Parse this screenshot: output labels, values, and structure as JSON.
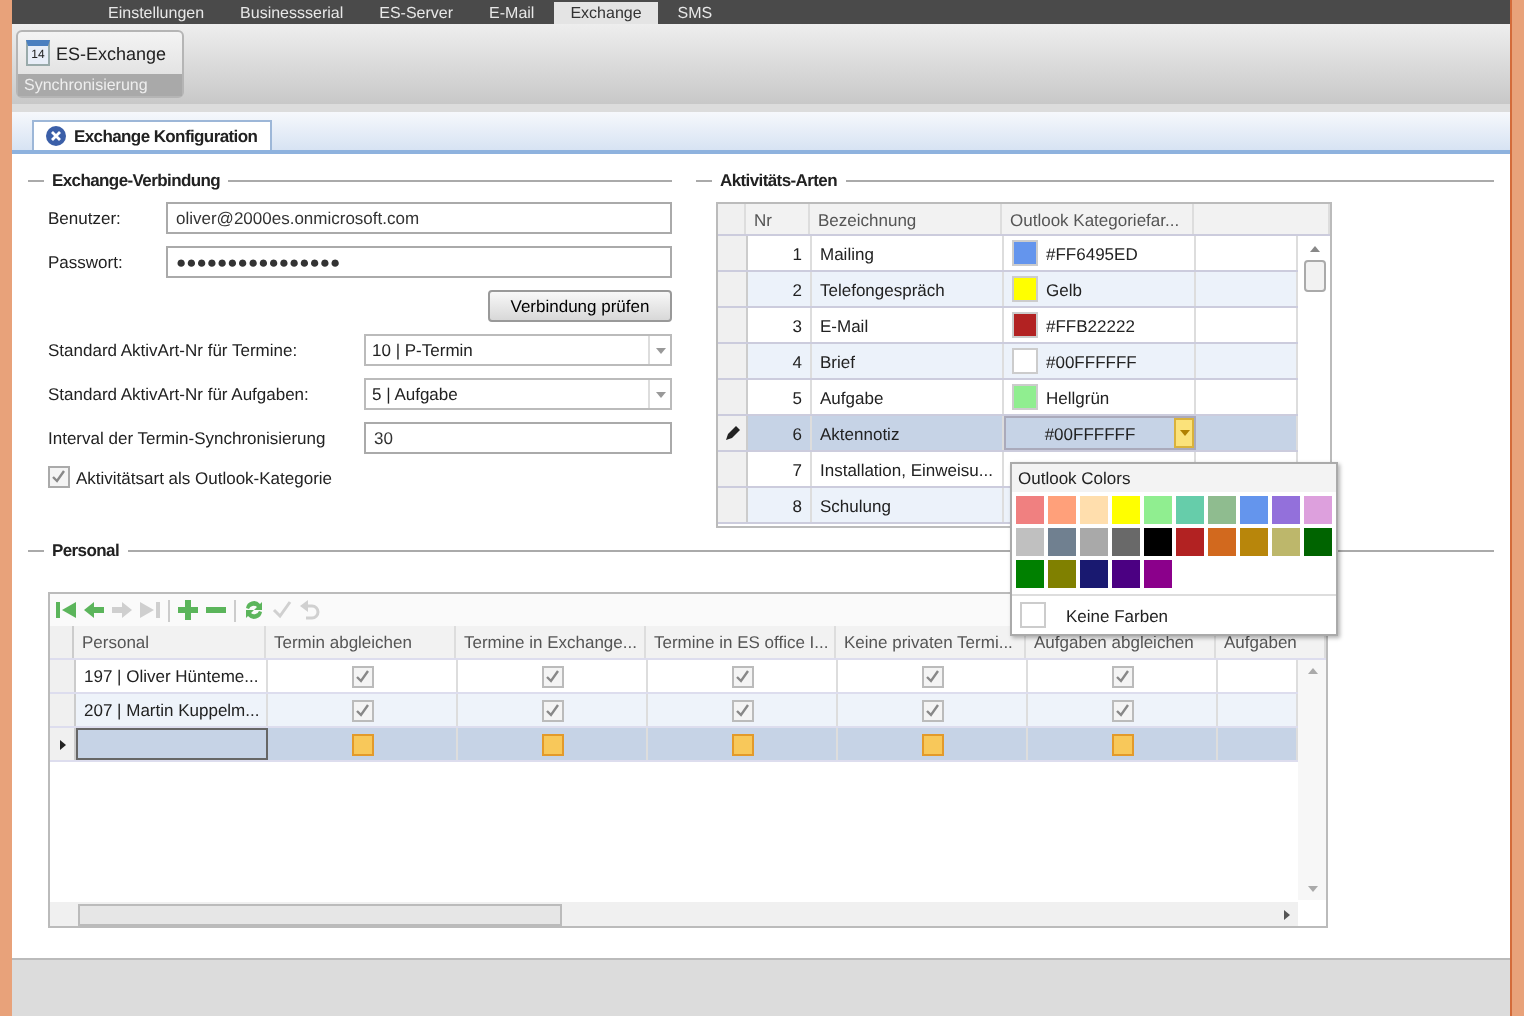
{
  "app_tabs": [
    {
      "label": "Einstellungen",
      "selected": false
    },
    {
      "label": "Businessserial",
      "selected": false
    },
    {
      "label": "ES-Server",
      "selected": false
    },
    {
      "label": "E-Mail",
      "selected": false
    },
    {
      "label": "Exchange",
      "selected": true
    },
    {
      "label": "SMS",
      "selected": false
    }
  ],
  "ribbon": {
    "button": {
      "icon_text": "14",
      "label": "ES-Exchange"
    },
    "group_label": "Synchronisierung"
  },
  "document_tab": {
    "label": "Exchange Konfiguration",
    "selected": true
  },
  "exchange_connection": {
    "title": "Exchange-Verbindung",
    "user": {
      "label": "Benutzer:",
      "value": "oliver@2000es.onmicrosoft.com"
    },
    "password": {
      "label": "Passwort:",
      "value": "●●●●●●●●●●●●●●●●"
    },
    "test_button": "Verbindung prüfen",
    "appointment_type": {
      "label": "Standard AktivArt-Nr für Termine:",
      "value": "10 | P-Termin"
    },
    "task_type": {
      "label": "Standard AktivArt-Nr für Aufgaben:",
      "value": "5 | Aufgabe"
    },
    "interval": {
      "label": "Interval der Termin-Synchronisierung",
      "value": "30"
    },
    "category_checkbox": {
      "label": "Aktivitätsart als Outlook-Kategorie",
      "checked": true
    }
  },
  "activity_types": {
    "title": "Aktivitäts-Arten",
    "columns": [
      "Nr",
      "Bezeichnung",
      "Outlook Kategoriefar..."
    ],
    "rows": [
      {
        "nr": "1",
        "name": "Mailing",
        "color": "#6495ed",
        "color_text": "#FF6495ED",
        "selected": false
      },
      {
        "nr": "2",
        "name": "Telefongespräch",
        "color": "#ffff00",
        "color_text": "Gelb",
        "selected": false
      },
      {
        "nr": "3",
        "name": "E-Mail",
        "color": "#b22222",
        "color_text": "#FFB22222",
        "selected": false
      },
      {
        "nr": "4",
        "name": "Brief",
        "color": "#ffffff",
        "color_text": "#00FFFFFF",
        "selected": false
      },
      {
        "nr": "5",
        "name": "Aufgabe",
        "color": "#90ee90",
        "color_text": "Hellgrün",
        "selected": false
      },
      {
        "nr": "6",
        "name": "Aktennotiz",
        "color_text": "#00FFFFFF",
        "selected": true
      },
      {
        "nr": "7",
        "name": "Installation, Einweisu...",
        "selected": false
      },
      {
        "nr": "8",
        "name": "Schulung",
        "selected": false
      }
    ],
    "color_popup": {
      "title": "Outlook Colors",
      "swatches": [
        {
          "color": "#f08080"
        },
        {
          "color": "#ffa07a"
        },
        {
          "color": "#ffdead"
        },
        {
          "color": "#ffff00"
        },
        {
          "color": "#90ee90"
        },
        {
          "color": "#66cdaa"
        },
        {
          "color": "#8fbc8f"
        },
        {
          "color": "#6495ed"
        },
        {
          "color": "#9370db"
        },
        {
          "color": "#dda0dd"
        },
        {
          "color": "#c0c0c0"
        },
        {
          "color": "#708090"
        },
        {
          "color": "#a9a9a9"
        },
        {
          "color": "#696969"
        },
        {
          "color": "#000000"
        },
        {
          "color": "#b22222"
        },
        {
          "color": "#d2691e"
        },
        {
          "color": "#b8860b"
        },
        {
          "color": "#bdb76b"
        },
        {
          "color": "#006400"
        },
        {
          "color": "#008000"
        },
        {
          "color": "#808000"
        },
        {
          "color": "#191970"
        },
        {
          "color": "#4b0082"
        },
        {
          "color": "#8b008b"
        }
      ],
      "no_color_label": "Keine Farben"
    }
  },
  "personnel": {
    "title": "Personal",
    "columns": [
      "Personal",
      "Termin abgleichen",
      "Termine in Exchange...",
      "Termine in ES office I...",
      "Keine privaten Termi...",
      "Aufgaben abgleichen",
      "Aufgaben"
    ],
    "rows": [
      {
        "kind": "data",
        "name": "197 | Oliver Hünteme...",
        "checks": [
          true,
          true,
          true,
          true,
          true
        ],
        "selected": false
      },
      {
        "kind": "data",
        "name": "207 | Martin Kuppelm...",
        "checks": [
          true,
          true,
          true,
          true,
          true
        ],
        "selected": false
      },
      {
        "kind": "new",
        "name": "",
        "selected": true
      }
    ]
  }
}
